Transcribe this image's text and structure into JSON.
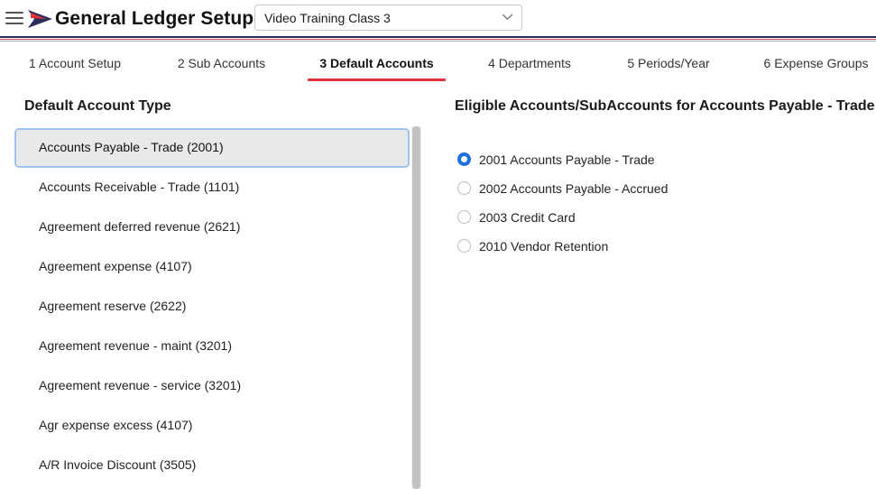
{
  "header": {
    "title": "General Ledger Setup",
    "company": "Video Training Class 3"
  },
  "tabs": [
    {
      "label": "1 Account Setup",
      "active": false
    },
    {
      "label": "2 Sub Accounts",
      "active": false
    },
    {
      "label": "3 Default Accounts",
      "active": true
    },
    {
      "label": "4 Departments",
      "active": false
    },
    {
      "label": "5 Periods/Year",
      "active": false
    },
    {
      "label": "6 Expense Groups",
      "active": false
    }
  ],
  "left_panel": {
    "heading": "Default Account Type",
    "items": [
      {
        "label": "Accounts Payable - Trade (2001)",
        "selected": true
      },
      {
        "label": "Accounts Receivable - Trade (1101)",
        "selected": false
      },
      {
        "label": "Agreement deferred revenue (2621)",
        "selected": false
      },
      {
        "label": "Agreement expense (4107)",
        "selected": false
      },
      {
        "label": "Agreement reserve (2622)",
        "selected": false
      },
      {
        "label": "Agreement revenue - maint (3201)",
        "selected": false
      },
      {
        "label": "Agreement revenue - service (3201)",
        "selected": false
      },
      {
        "label": "Agr expense excess (4107)",
        "selected": false
      },
      {
        "label": "A/R Invoice Discount (3505)",
        "selected": false
      }
    ]
  },
  "right_panel": {
    "heading": "Eligible Accounts/SubAccounts for Accounts Payable - Trade",
    "options": [
      {
        "label": "2001 Accounts Payable - Trade",
        "checked": true
      },
      {
        "label": "2002 Accounts Payable - Accrued",
        "checked": false
      },
      {
        "label": "2003 Credit Card",
        "checked": false
      },
      {
        "label": "2010 Vendor Retention",
        "checked": false
      }
    ]
  },
  "colors": {
    "accent_red": "#e0323c",
    "selection_border": "#9cc3ee",
    "radio_blue": "#1d6fe0",
    "logo_navy": "#2d2d5e"
  },
  "icons": {
    "menu": "hamburger-menu-icon",
    "logo": "flag-logo-icon",
    "dropdown": "chevron-down-icon"
  }
}
